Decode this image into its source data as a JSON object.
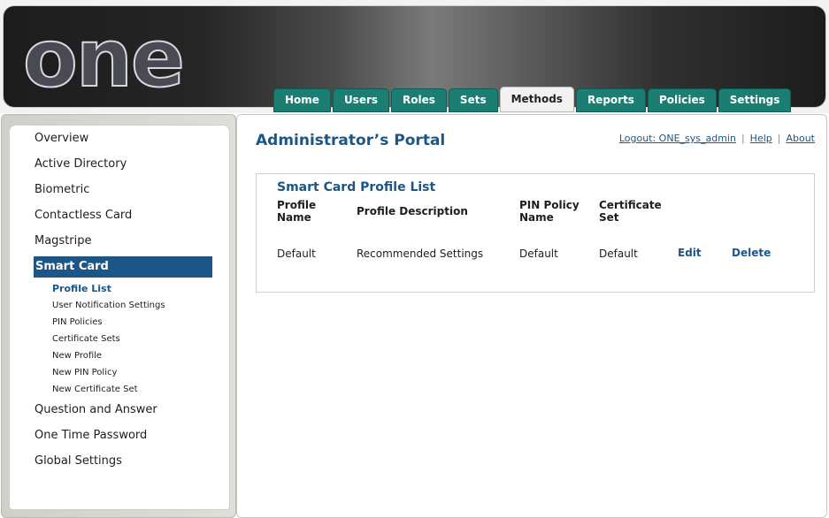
{
  "header": {
    "logo": "one"
  },
  "tabs": [
    {
      "label": "Home"
    },
    {
      "label": "Users"
    },
    {
      "label": "Roles"
    },
    {
      "label": "Sets"
    },
    {
      "label": "Methods",
      "active": true
    },
    {
      "label": "Reports"
    },
    {
      "label": "Policies"
    },
    {
      "label": "Settings"
    }
  ],
  "sidebar": {
    "items": [
      {
        "label": "Overview"
      },
      {
        "label": "Active Directory"
      },
      {
        "label": "Biometric"
      },
      {
        "label": "Contactless Card"
      },
      {
        "label": "Magstripe"
      },
      {
        "label": "Smart Card",
        "active": true
      },
      {
        "label": "Question and Answer"
      },
      {
        "label": "One Time Password"
      },
      {
        "label": "Global Settings"
      }
    ],
    "subitems": [
      {
        "label": "Profile List",
        "active": true
      },
      {
        "label": "User Notification Settings"
      },
      {
        "label": "PIN Policies"
      },
      {
        "label": "Certificate Sets"
      },
      {
        "label": "New Profile"
      },
      {
        "label": "New PIN Policy"
      },
      {
        "label": "New Certificate Set"
      }
    ]
  },
  "main": {
    "title": "Administrator’s Portal",
    "links": {
      "logout": "Logout: ONE_sys_admin",
      "help": "Help",
      "about": "About",
      "separator": "|"
    },
    "panel": {
      "title": "Smart Card Profile List",
      "columns": {
        "name_line1": "Profile",
        "name_line2": "Name",
        "description": "Profile Description",
        "pin_line1": "PIN Policy",
        "pin_line2": "Name",
        "cert_line1": "Certificate",
        "cert_line2": "Set"
      },
      "rows": [
        {
          "name": "Default",
          "description": "Recommended Settings",
          "pin_policy": "Default",
          "certificate_set": "Default",
          "edit": "Edit",
          "delete": "Delete"
        }
      ]
    }
  },
  "colors": {
    "accent": "#1c5687",
    "tab": "#1a7f72"
  }
}
